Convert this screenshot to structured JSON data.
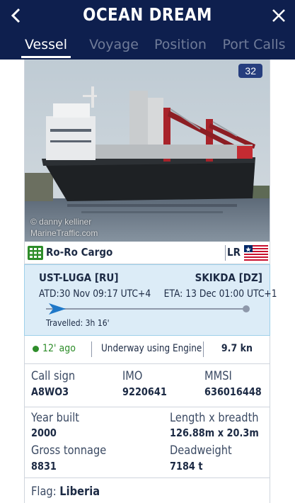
{
  "header": {
    "title": "OCEAN DREAM",
    "back_icon": "chevron-left-icon",
    "close_icon": "close-icon",
    "tabs": [
      {
        "label": "Vessel",
        "active": true
      },
      {
        "label": "Voyage",
        "active": false
      },
      {
        "label": "Position",
        "active": false
      },
      {
        "label": "Port Calls",
        "active": false
      }
    ]
  },
  "photo": {
    "count": "32",
    "watermark_line1": "© danny kelliner",
    "watermark_line2": "MarineTraffic.com"
  },
  "vessel_type": {
    "label": "Ro-Ro Cargo",
    "icon": "vessel-type-grid-icon",
    "flag_code": "LR",
    "flag_icon": "liberia-flag-icon"
  },
  "voyage": {
    "from_port": "UST-LUGA [RU]",
    "to_port": "SKIKDA [DZ]",
    "atd_label": "ATD:",
    "atd_value": "30 Nov 09:17 UTC+4",
    "eta_label": "ETA:",
    "eta_value": "13 Dec 01:00 UTC+1",
    "travelled": "Travelled: 3h 16'",
    "progress": 0.02
  },
  "status": {
    "ago": "12' ago",
    "navigation_status": "Underway using Engine",
    "speed": "9.7 kn",
    "dot_color": "#2e8d2a"
  },
  "identifiers": {
    "call_sign_label": "Call sign",
    "call_sign_value": "A8WO3",
    "imo_label": "IMO",
    "imo_value": "9220641",
    "mmsi_label": "MMSI",
    "mmsi_value": "636016448"
  },
  "dimensions": {
    "year_built_label": "Year built",
    "year_built_value": "2000",
    "length_breadth_label": "Length x breadth",
    "length_breadth_value": "126.88m x 20.3m",
    "gross_tonnage_label": "Gross tonnage",
    "gross_tonnage_value": "8831",
    "deadweight_label": "Deadweight",
    "deadweight_value": "7184 t"
  },
  "flag": {
    "label": "Flag:",
    "value": "Liberia"
  },
  "colors": {
    "header_bg": "#0e1f4e",
    "voyage_bg": "#dcecf7",
    "accent_blue": "#1f78c8"
  }
}
